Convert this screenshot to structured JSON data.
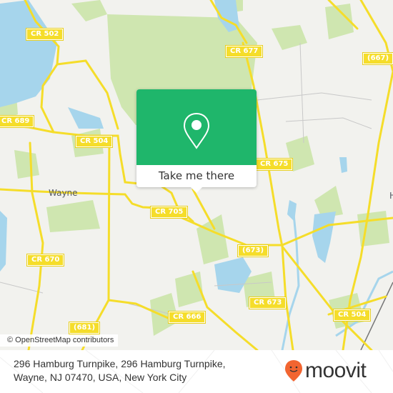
{
  "map": {
    "attribution": "© OpenStreetMap contributors",
    "place_labels": {
      "wayne": "Wayne",
      "partial_h": "H"
    },
    "road_shields": {
      "cr502": "CR 502",
      "cr677": "CR 677",
      "r667": "(667)",
      "cr689": "CR 689",
      "cr504_w": "CR 504",
      "cr675": "CR 675",
      "cr705": "CR 705",
      "cr670": "CR 670",
      "r673": "(673)",
      "cr673": "CR 673",
      "cr666": "CR 666",
      "cr504_e": "CR 504",
      "r681": "(681)"
    },
    "colors": {
      "land": "#f2f2ee",
      "park": "#cfe6b0",
      "water": "#a6d5ec",
      "road": "#f5dd2a",
      "brand_green": "#1fb66b",
      "moovit_orange": "#f26530"
    }
  },
  "popup": {
    "icon": "map-pin-icon",
    "cta_label": "Take me there"
  },
  "footer": {
    "address_line1": "296 Hamburg Turnpike, 296 Hamburg Turnpike,",
    "address_line2": "Wayne, NJ 07470, USA, New York City",
    "logo_text": "moovit",
    "logo_icon": "moovit-smile-pin-icon"
  }
}
